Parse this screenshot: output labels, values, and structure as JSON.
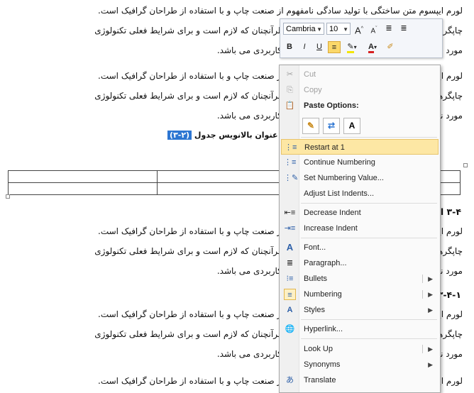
{
  "document": {
    "paragraph1": [
      "لورم ایپسوم متن ساختگی با تولید سادگی نامفهوم از صنعت چاپ و با استفاده از طراحان گرافیک است.",
      "چاپگرها و متون بلکه روزنامه و مجله در ستون و سطرآنچنان که لازم است و برای شرایط فعلی تکنولوژی",
      "مورد نیاز و کاربردهای متنوع با هدف بهبود ابزارهای کاربردی می باشد."
    ],
    "paragraph2": [
      "لورم ایپسوم متن ساختگی با تولید سادگی نامفهوم از صنعت چاپ و با استفاده از طراحان گرافیک است.",
      "چاپگرها و متون بلکه روزنامه و مجله در ستون و سطرآنچنان که لازم است و برای شرایط فعلی تکنولوژی",
      "مورد نیاز و کاربردهای متنوع با هدف بهبود ابزارهای کاربردی می باشد."
    ],
    "caption_number": "(۲-۳)",
    "caption_text": "عنوان بالانویس جدول",
    "heading1": "۳-۴ ابزارها",
    "paragraph3": [
      "لورم ایپسوم متن ساختگی با تولید سادگی نامفهوم از صنعت چاپ و با استفاده از طراحان گرافیک است.",
      "چاپگرها و متون بلکه روزنامه و مجله در ستون و سطرآنچنان که لازم است و برای شرایط فعلی تکنولوژی",
      "مورد نیاز و کاربردهای متنوع با هدف بهبود ابزارهای کاربردی می باشد."
    ],
    "heading2": "۳-۴-۱ تعیین",
    "paragraph4": [
      "لورم ایپسوم متن ساختگی با تولید سادگی نامفهوم از صنعت چاپ و با استفاده از طراحان گرافیک است.",
      "چاپگرها و متون بلکه روزنامه و مجله در ستون و سطرآنچنان که لازم است و برای شرایط فعلی تکنولوژی",
      "مورد نیاز و کاربردهای متنوع با هدف بهبود ابزارهای کاربردی می باشد.",
      "لورم ایپسوم متن ساختگی با تولید سادگی نامفهوم از صنعت چاپ و با استفاده از طراحان گرافیک است."
    ]
  },
  "mini_toolbar": {
    "font": "Cambria",
    "size": "10",
    "grow_font": "A",
    "shrink_font": "A",
    "bold": "B",
    "italic": "I",
    "underline": "U",
    "font_color": "A"
  },
  "context_menu": {
    "cut": "Cut",
    "copy": "Copy",
    "paste_options_header": "Paste Options:",
    "paste_text_only": "A",
    "items": [
      {
        "label": "Restart at 1",
        "icon": "restart-numbering-icon",
        "highlighted": true
      },
      {
        "label": "Continue Numbering",
        "icon": "continue-numbering-icon"
      },
      {
        "label": "Set Numbering Value...",
        "icon": "set-numbering-value-icon"
      },
      {
        "label": "Adjust List Indents...",
        "icon": ""
      },
      {
        "label": "Decrease Indent",
        "icon": "decrease-indent-icon"
      },
      {
        "label": "Increase Indent",
        "icon": "increase-indent-icon"
      },
      {
        "label": "Font...",
        "icon": "font-icon"
      },
      {
        "label": "Paragraph...",
        "icon": "paragraph-icon"
      },
      {
        "label": "Bullets",
        "icon": "bullets-icon",
        "submenu": true
      },
      {
        "label": "Numbering",
        "icon": "numbering-icon",
        "submenu": true
      },
      {
        "label": "Styles",
        "icon": "styles-icon",
        "submenu": true
      },
      {
        "label": "Hyperlink...",
        "icon": "hyperlink-icon"
      },
      {
        "label": "Look Up",
        "icon": "",
        "submenu": true
      },
      {
        "label": "Synonyms",
        "icon": "",
        "submenu": true
      },
      {
        "label": "Translate",
        "icon": "translate-icon"
      }
    ]
  },
  "colors": {
    "highlight": "#fde7a4",
    "caption_number_bg": "#2d76d2"
  }
}
